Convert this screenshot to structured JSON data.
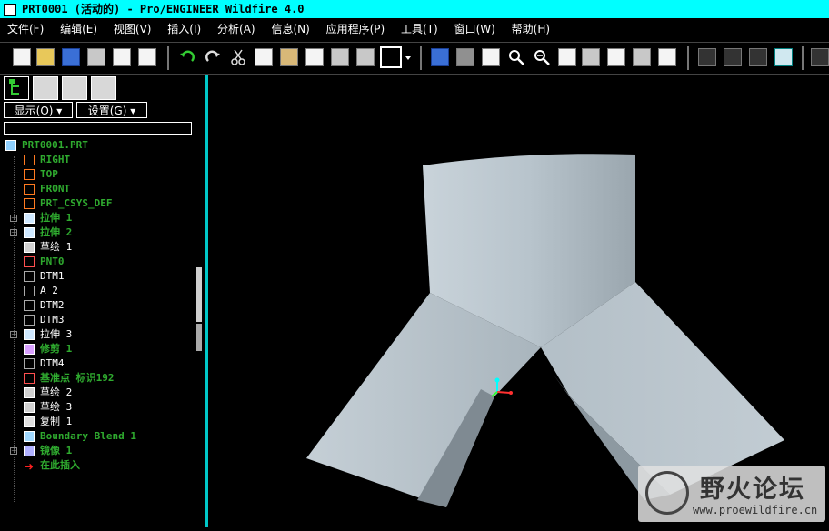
{
  "window": {
    "title": "PRT0001 (活动的) - Pro/ENGINEER Wildfire 4.0"
  },
  "menu": [
    "文件(F)",
    "编辑(E)",
    "视图(V)",
    "插入(I)",
    "分析(A)",
    "信息(N)",
    "应用程序(P)",
    "工具(T)",
    "窗口(W)",
    "帮助(H)"
  ],
  "sidebar": {
    "display_label": "显示(O) ▾",
    "settings_label": "设置(G) ▾"
  },
  "tree": [
    {
      "label": "PRT0001.PRT",
      "icon": "part-icon",
      "style": "green"
    },
    {
      "label": "RIGHT",
      "icon": "datum-plane-icon",
      "style": "green"
    },
    {
      "label": "TOP",
      "icon": "datum-plane-icon",
      "style": "green"
    },
    {
      "label": "FRONT",
      "icon": "datum-plane-icon",
      "style": "green"
    },
    {
      "label": "PRT_CSYS_DEF",
      "icon": "coordinate-system-icon",
      "style": "green"
    },
    {
      "label": "拉伸 1",
      "icon": "extrude-icon",
      "style": "green"
    },
    {
      "label": "拉伸 2",
      "icon": "extrude-icon",
      "style": "green"
    },
    {
      "label": "草绘 1",
      "icon": "sketch-icon",
      "style": "white"
    },
    {
      "label": "PNT0",
      "icon": "datum-point-icon",
      "style": "green"
    },
    {
      "label": "DTM1",
      "icon": "datum-plane-icon",
      "style": "white"
    },
    {
      "label": "A_2",
      "icon": "datum-axis-icon",
      "style": "white"
    },
    {
      "label": "DTM2",
      "icon": "datum-plane-icon",
      "style": "white"
    },
    {
      "label": "DTM3",
      "icon": "datum-plane-icon",
      "style": "white"
    },
    {
      "label": "拉伸 3",
      "icon": "extrude-icon",
      "style": "white"
    },
    {
      "label": "修剪 1",
      "icon": "trim-icon",
      "style": "green"
    },
    {
      "label": "DTM4",
      "icon": "datum-plane-icon",
      "style": "white"
    },
    {
      "label": "基准点 标识192",
      "icon": "datum-point-icon",
      "style": "green"
    },
    {
      "label": "草绘 2",
      "icon": "sketch-icon",
      "style": "white"
    },
    {
      "label": "草绘 3",
      "icon": "sketch-icon",
      "style": "white"
    },
    {
      "label": "复制 1",
      "icon": "copy-icon",
      "style": "white"
    },
    {
      "label": "Boundary Blend 1",
      "icon": "boundary-blend-icon",
      "style": "green"
    },
    {
      "label": "镜像 1",
      "icon": "mirror-icon",
      "style": "green"
    },
    {
      "label": "在此插入",
      "icon": "insert-here-arrow-icon",
      "style": "green"
    }
  ],
  "watermark": {
    "title": "野火论坛",
    "url": "www.proewildfire.cn"
  },
  "colors": {
    "title_bg": "#00ffff",
    "green_text": "#2faa2f",
    "model_surface": "#b8c4cc",
    "viewport_border": "#00c8c8"
  }
}
